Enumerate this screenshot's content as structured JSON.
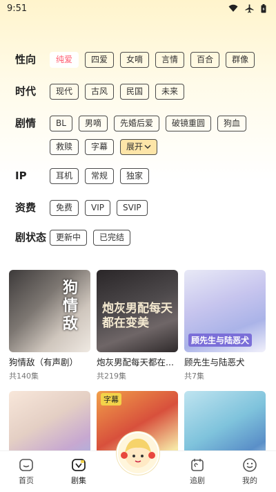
{
  "status": {
    "time": "9:51"
  },
  "filters": {
    "gender": {
      "label": "性向",
      "chips": [
        "纯爱",
        "四爱",
        "女嘀",
        "言情",
        "百合",
        "群像"
      ],
      "active": 0
    },
    "era": {
      "label": "时代",
      "chips": [
        "现代",
        "古风",
        "民国",
        "未来"
      ]
    },
    "plot": {
      "label": "剧情",
      "chips": [
        "BL",
        "男嘀",
        "先婚后爱",
        "破镜重圆",
        "狗血",
        "救赎",
        "字幕"
      ],
      "expand": "展开"
    },
    "ip": {
      "label": "IP",
      "chips": [
        "耳机",
        "常规",
        "独家"
      ]
    },
    "fee": {
      "label": "资费",
      "chips": [
        "免费",
        "VIP",
        "SVIP"
      ]
    },
    "state": {
      "label": "剧状态",
      "chips": [
        "更新中",
        "已完结"
      ]
    }
  },
  "cards": [
    {
      "title": "狗情敌（有声剧）",
      "count": "共140集",
      "cover_text": "狗情敌"
    },
    {
      "title": "炮灰男配每天都在...",
      "count": "共219集",
      "cover_text": "炮灰男配每天都在变美"
    },
    {
      "title": "顾先生与陆恶犬",
      "count": "共7集",
      "cover_text": "顾先生与陆恶犬"
    },
    {
      "tag": ""
    },
    {
      "tag": "字幕"
    },
    {
      "tag": ""
    }
  ],
  "nav": {
    "home": "首页",
    "series": "剧集",
    "follow": "追剧",
    "me": "我的"
  },
  "colors": {
    "accent": "#ff5a6e",
    "expand_bg": "#fde5a8"
  }
}
